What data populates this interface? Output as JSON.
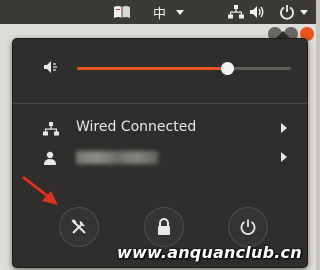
{
  "topbar": {
    "input_method": "中",
    "icons": [
      "book-icon",
      "network-icon",
      "volume-icon",
      "power-icon"
    ]
  },
  "volume": {
    "level_percent": 70
  },
  "network": {
    "label": "Wired Connected"
  },
  "user": {
    "name_hidden": true
  },
  "actions": [
    "settings-icon",
    "lock-icon",
    "power-icon"
  ],
  "watermark": "www.anquanclub.cn",
  "colors": {
    "accent": "#e95420",
    "menu_bg": "#2f2e2c",
    "text": "#e8e8e8",
    "annotation_arrow": "#e0301e"
  }
}
